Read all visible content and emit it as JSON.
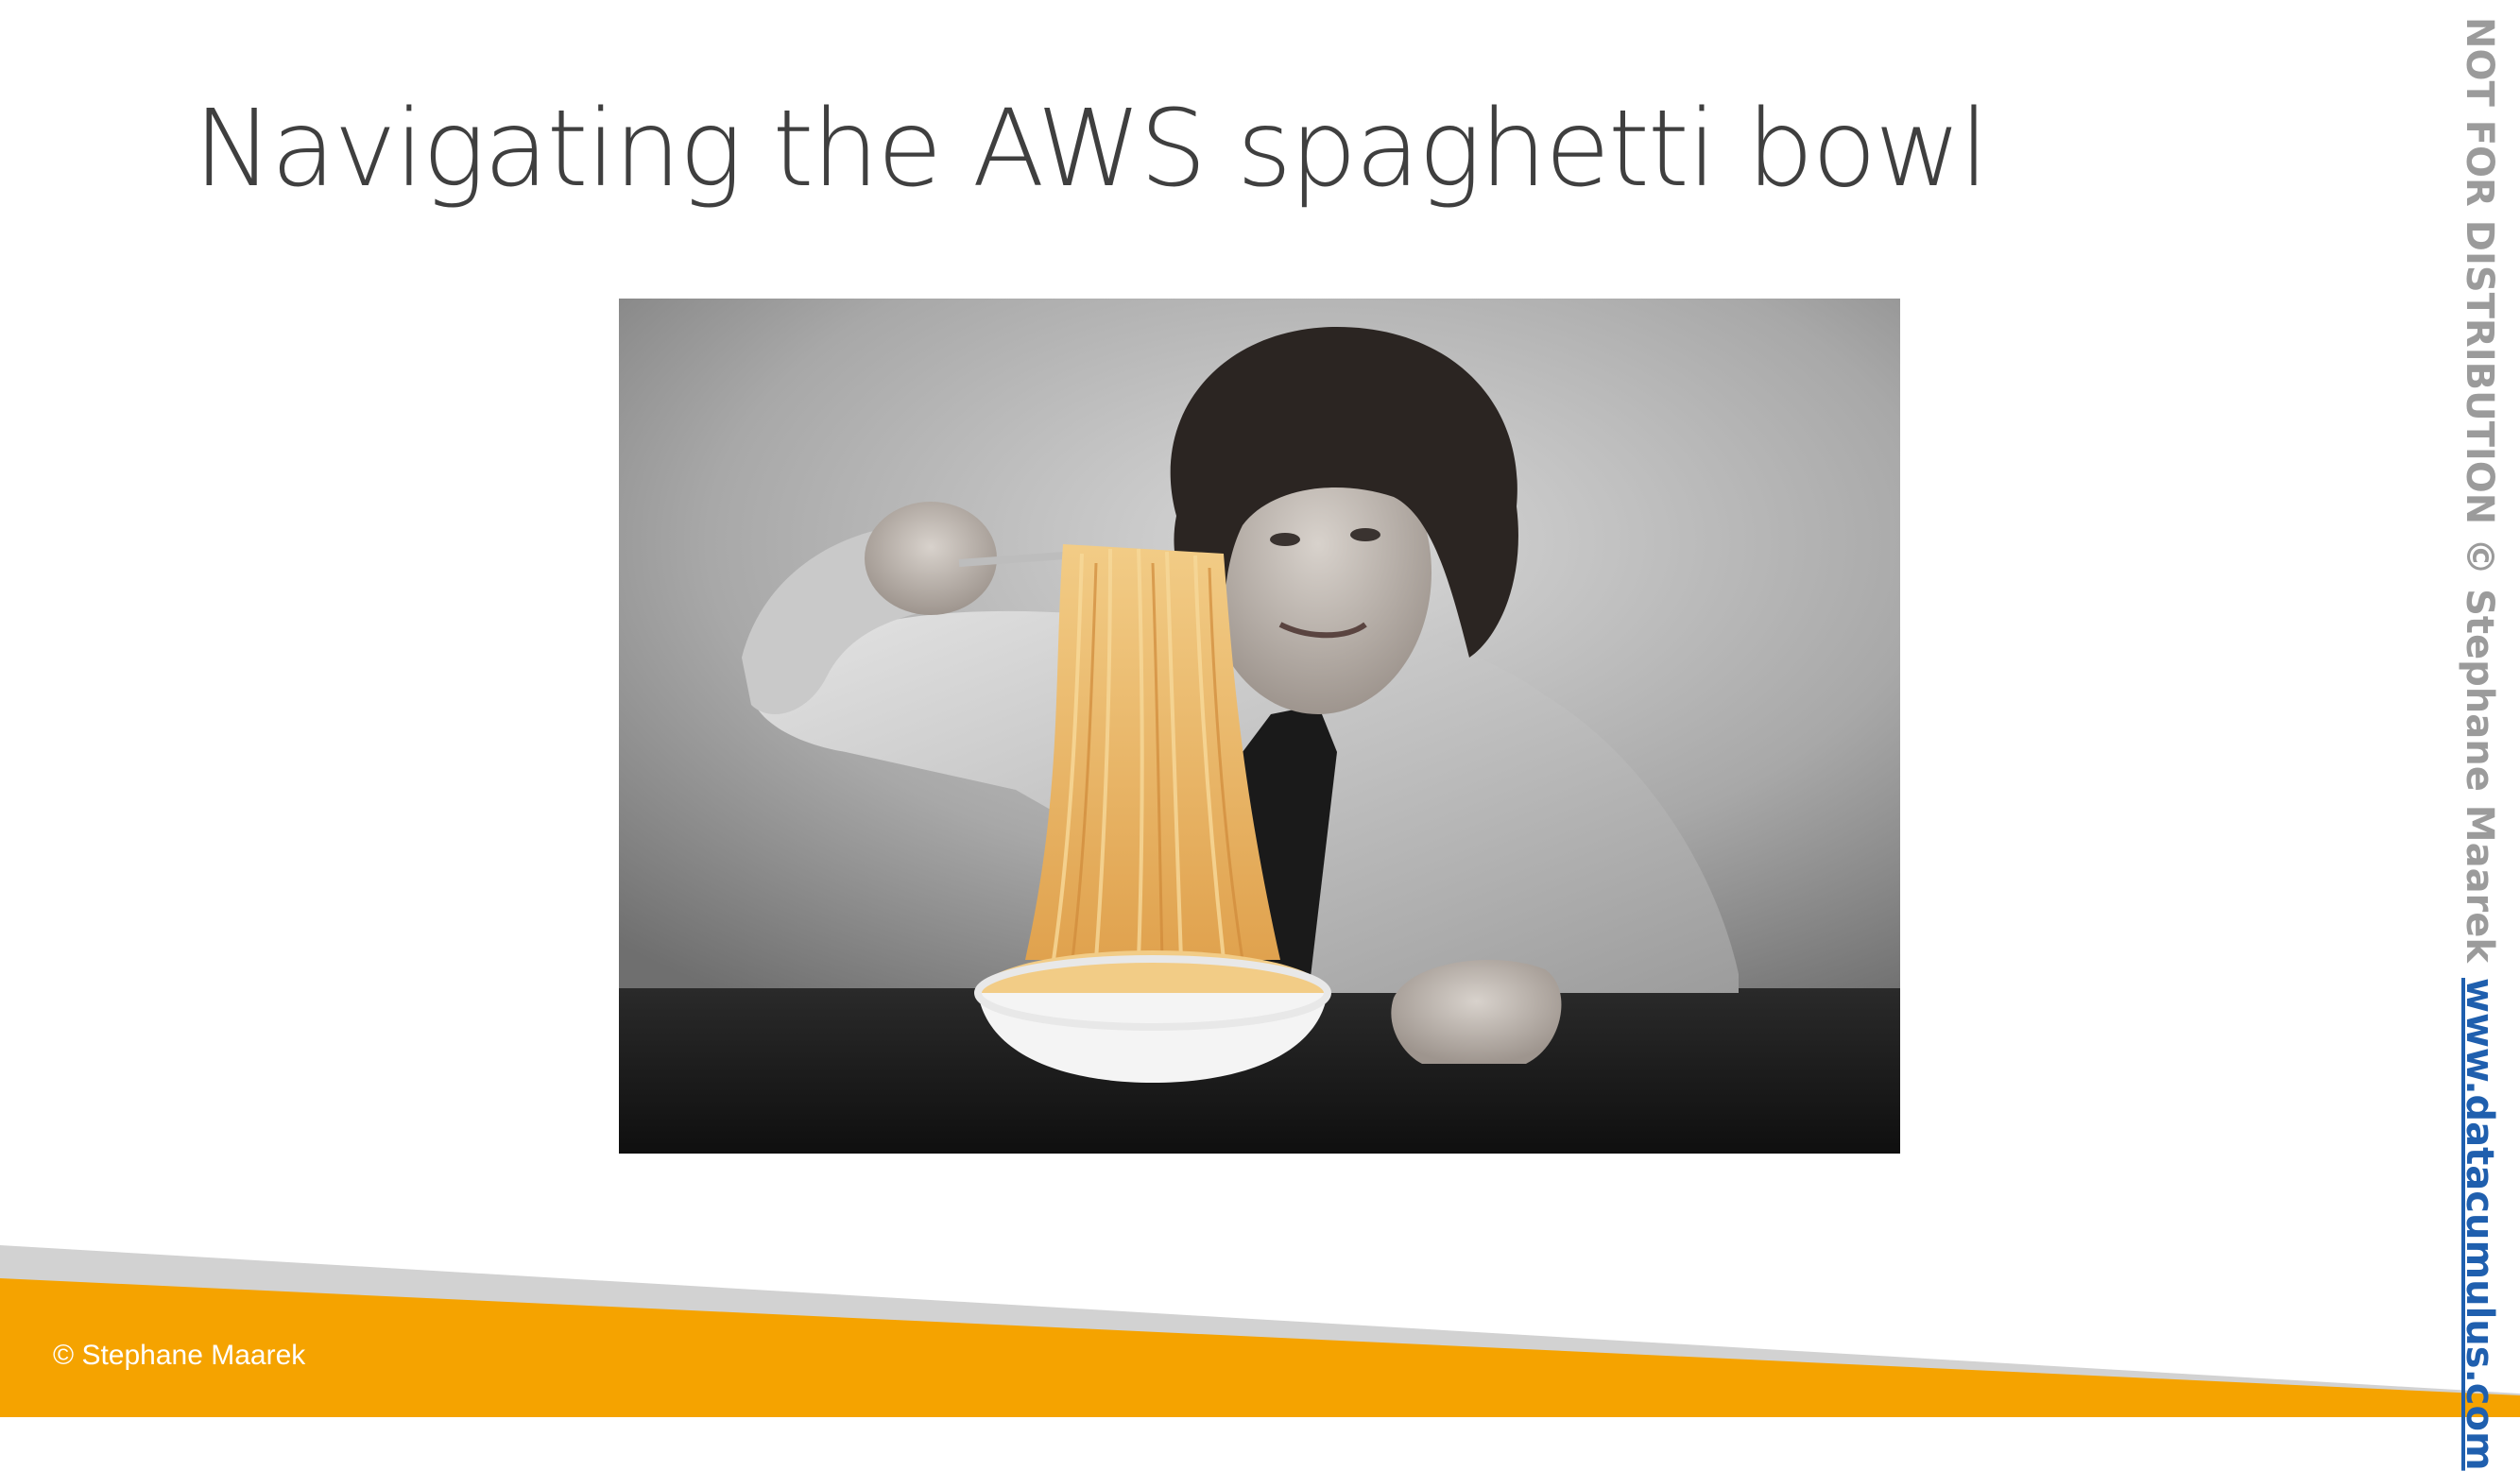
{
  "slide": {
    "title": "Navigating the AWS spaghetti bowl"
  },
  "side_banner": {
    "notice": "NOT FOR DISTRIBUTION © Stephane Maarek",
    "link": "www.datacumulus.com"
  },
  "footer": {
    "copyright": "© Stephane Maarek"
  },
  "colors": {
    "accent_orange": "#f5a300",
    "footer_gray": "#d2d2d2",
    "title_text": "#3f3f3f",
    "link_blue": "#1f5fae",
    "notice_gray": "#9b9b9b"
  },
  "image": {
    "subject": "man with curly hair in gray shirt and black tie lifting a huge forkful of spaghetti from a white bowl on a dark table"
  }
}
